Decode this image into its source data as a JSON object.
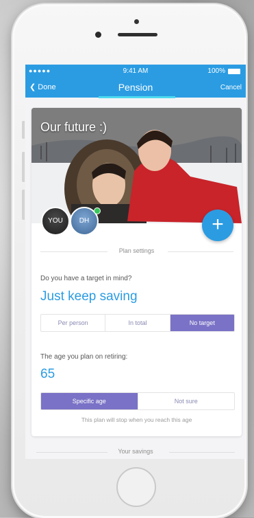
{
  "status_bar": {
    "carrier": "●●●●● ",
    "time": "9:41 AM",
    "battery": "100%"
  },
  "nav": {
    "back_label": "❮ Done",
    "title": "Pension",
    "cancel_label": "Cancel"
  },
  "photo": {
    "caption": "Our future :)"
  },
  "members": [
    {
      "initials": "YOU"
    },
    {
      "initials": "DH"
    }
  ],
  "add_button": "+",
  "plan_settings": {
    "section_label": "Plan settings",
    "target_question": "Do you have a target in mind?",
    "target_value": "Just keep saving",
    "target_options": [
      "Per person",
      "In total",
      "No target"
    ],
    "target_selected": "No target",
    "age_question": "The age you plan on retiring:",
    "age_value": "65",
    "age_options": [
      "Specific age",
      "Not sure"
    ],
    "age_selected": "Specific age",
    "age_note": "This plan will stop when you reach this age"
  },
  "savings": {
    "section_label": "Your savings"
  },
  "colors": {
    "accent_blue": "#2b9ce2",
    "selected_purple": "#7a72c6"
  }
}
